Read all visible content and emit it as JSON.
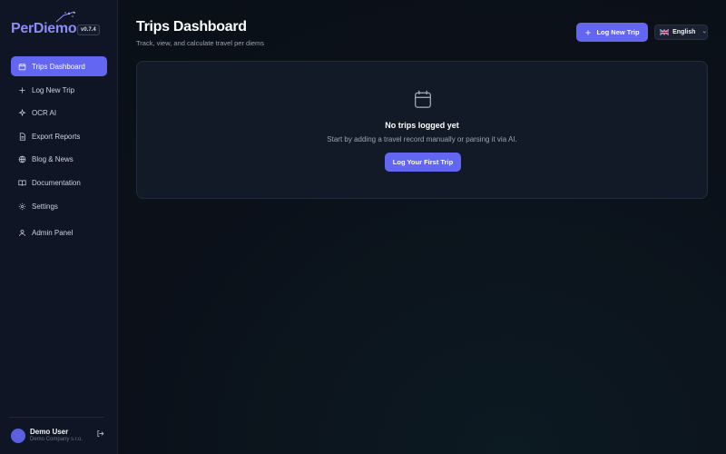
{
  "app": {
    "logo_text": "PerDiemo",
    "version": "v0.7.4"
  },
  "sidebar": {
    "items": [
      {
        "label": "Trips Dashboard",
        "icon": "calendar-icon",
        "active": true
      },
      {
        "label": "Log New Trip",
        "icon": "plus-icon"
      },
      {
        "label": "OCR AI",
        "icon": "sparkle-icon"
      },
      {
        "label": "Export Reports",
        "icon": "document-icon"
      },
      {
        "label": "Blog & News",
        "icon": "globe-icon"
      },
      {
        "label": "Documentation",
        "icon": "book-icon"
      },
      {
        "label": "Settings",
        "icon": "gear-icon"
      },
      {
        "label": "Admin Panel",
        "icon": "user-icon"
      }
    ],
    "user": {
      "name": "Demo User",
      "company": "Demo Company s.r.o."
    }
  },
  "header": {
    "title": "Trips Dashboard",
    "subtitle": "Track, view, and calculate travel per diems",
    "primary_button": "Log New Trip",
    "language": "English"
  },
  "empty_state": {
    "icon": "calendar-icon",
    "title": "No trips logged yet",
    "description": "Start by adding a travel record manually or parsing it via AI.",
    "button": "Log Your First Trip"
  },
  "colors": {
    "accent": "#6366f1",
    "background": "#0b1019",
    "sidebar": "#0f1524",
    "card": "#131a27"
  }
}
